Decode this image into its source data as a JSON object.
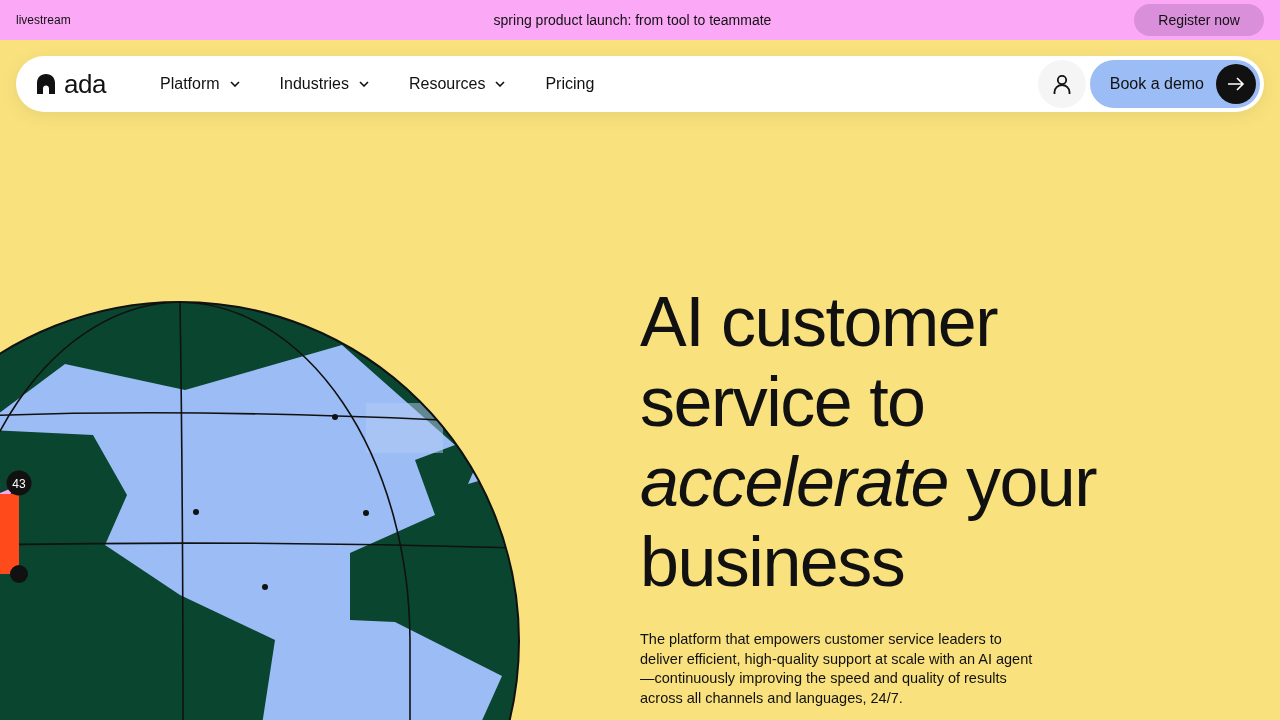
{
  "banner": {
    "tag": "livestream",
    "message": "spring product launch: from tool to teammate",
    "button": "Register now"
  },
  "nav": {
    "logo": "ada",
    "items": [
      {
        "label": "Platform",
        "has_menu": true
      },
      {
        "label": "Industries",
        "has_menu": true
      },
      {
        "label": "Resources",
        "has_menu": true
      },
      {
        "label": "Pricing",
        "has_menu": false
      }
    ],
    "cta": "Book a demo"
  },
  "globe": {
    "badge": "43"
  },
  "hero": {
    "heading": "AI customer service to *accelerate* your business",
    "body": "The platform that empowers customer service leaders to deliver efficient, high-quality support at scale with an AI agent—continuously improving the speed and quality of results across all channels and languages, 24/7."
  }
}
